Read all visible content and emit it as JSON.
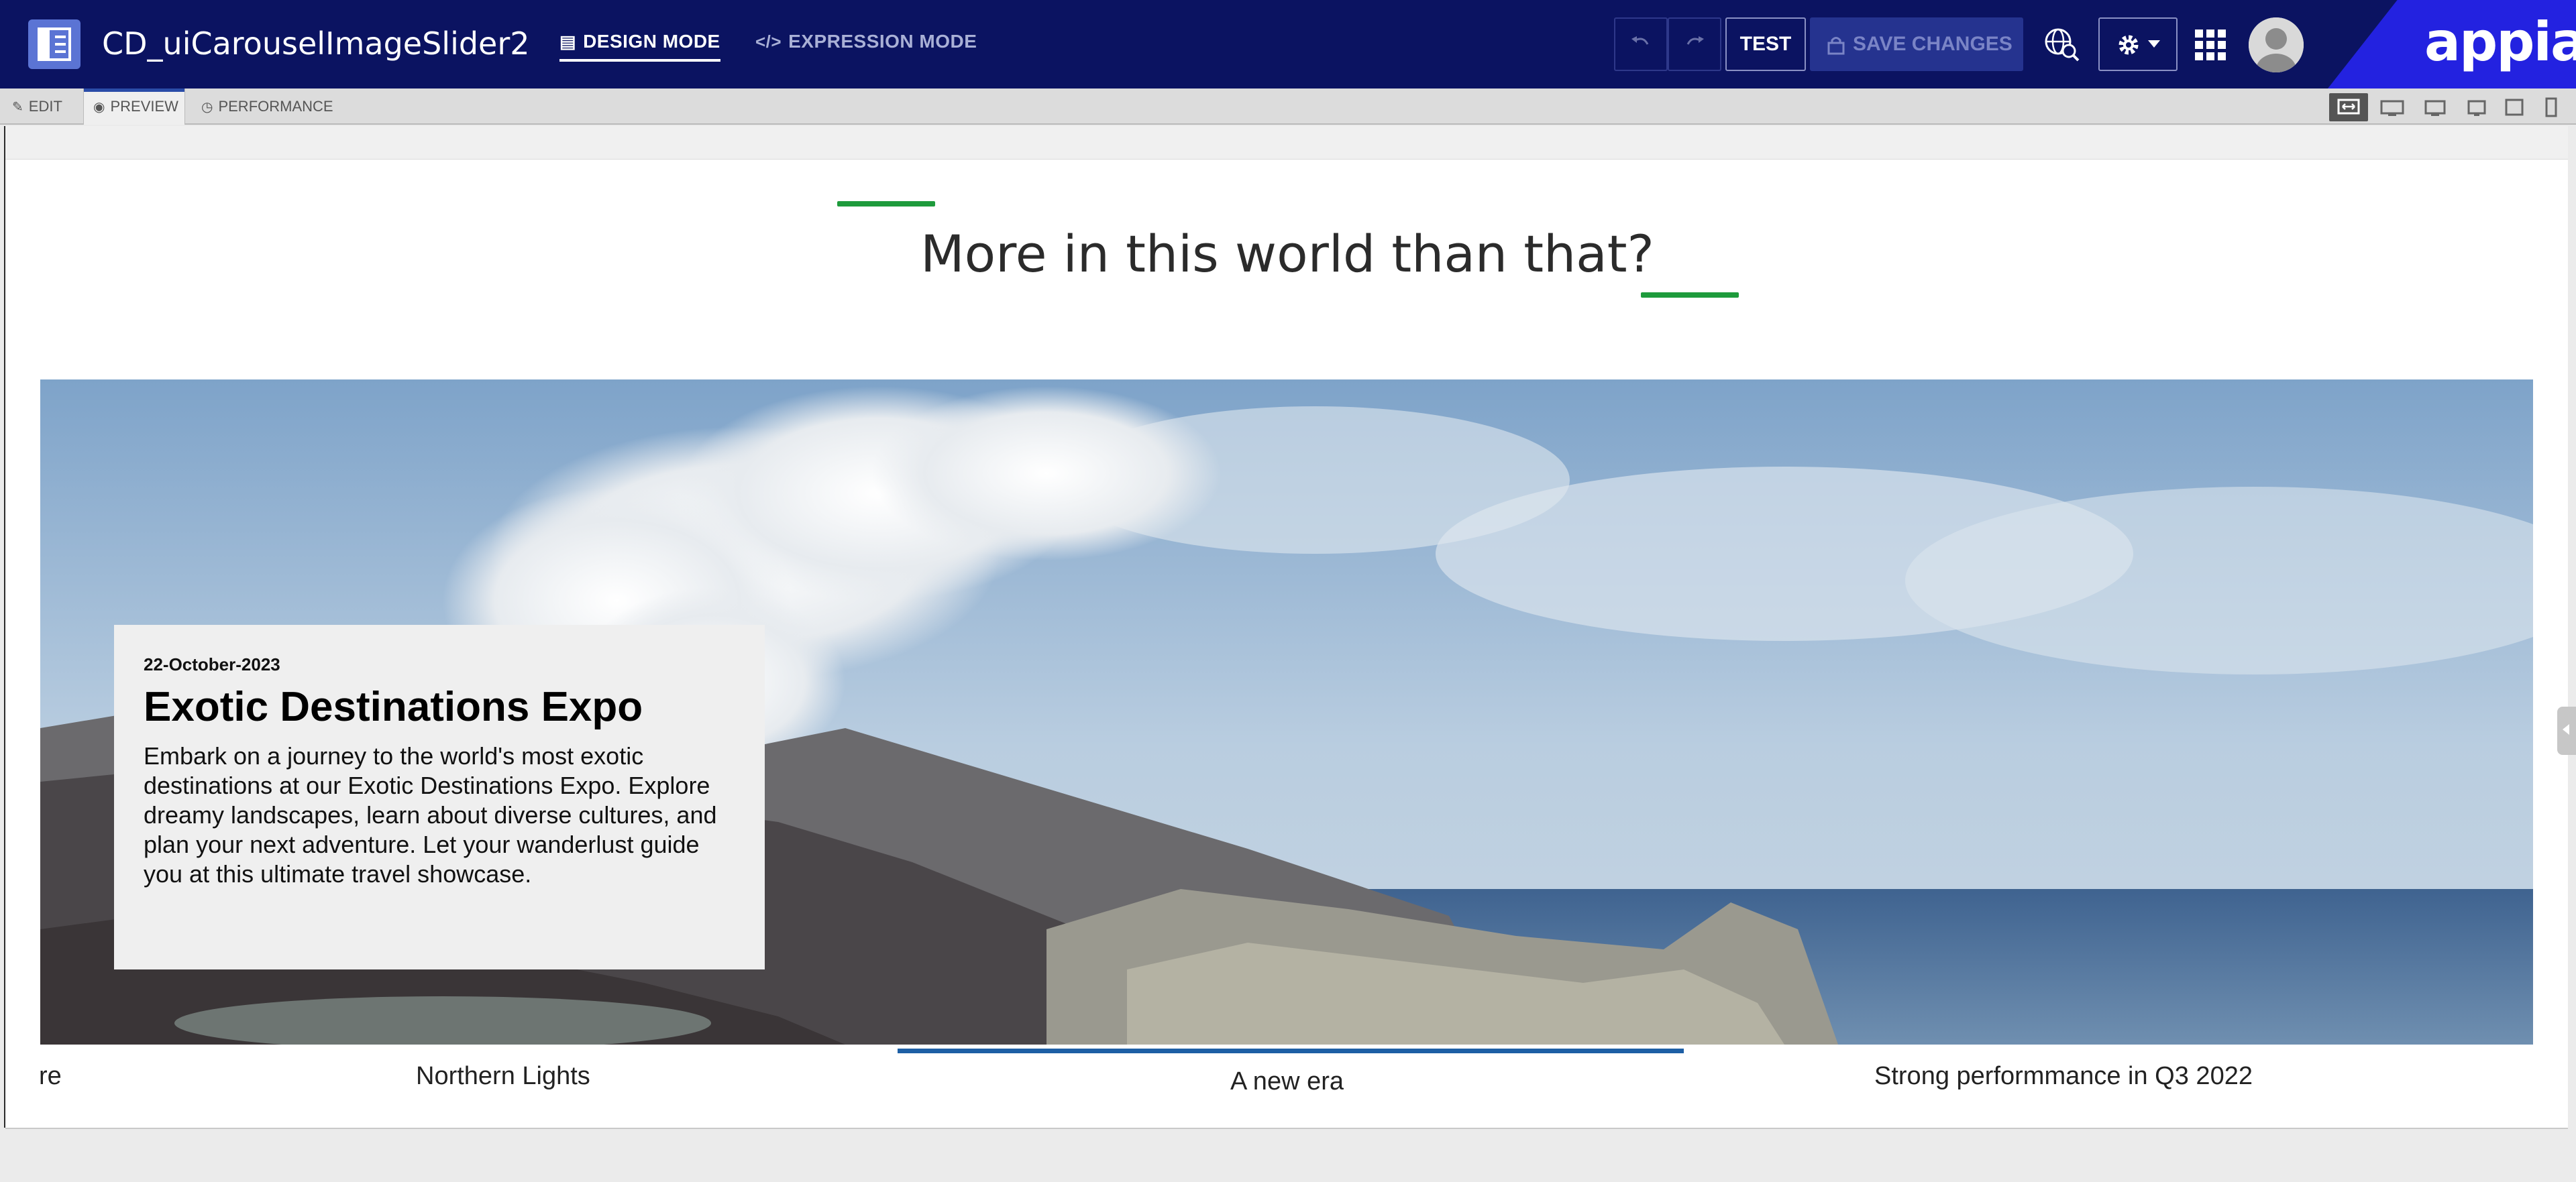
{
  "header": {
    "app_title": "CD_uiCarouselImageSlider2",
    "design_mode_label": "DESIGN MODE",
    "expression_mode_label": "EXPRESSION MODE",
    "test_label": "TEST",
    "save_label": "SAVE CHANGES",
    "logo_text": "appian"
  },
  "subbar": {
    "edit_label": "EDIT",
    "preview_label": "PREVIEW",
    "performance_label": "PERFORMANCE",
    "devices": [
      "fit-width-icon",
      "desktop-large-icon",
      "desktop-icon",
      "monitor-icon",
      "tablet-icon",
      "phone-icon"
    ]
  },
  "content": {
    "heading": "More in this world than that?",
    "card": {
      "date": "22-October-2023",
      "title": "Exotic Destinations Expo",
      "body": "Embark on a journey to the world's most exotic destinations at our Exotic Destinations Expo. Explore dreamy landscapes, learn about diverse cultures, and plan your next adventure. Let your wanderlust guide you at this ultimate travel showcase."
    },
    "slide_tabs": [
      "re",
      "Northern Lights",
      "A new era",
      "Strong performmance in Q3 2022"
    ],
    "active_tab": "A new era"
  },
  "colors": {
    "header_bg": "#0b1361",
    "logo_bg": "#2322e0",
    "accent_green": "#1e9b3c",
    "active_tab_blue": "#1d5fa5"
  }
}
